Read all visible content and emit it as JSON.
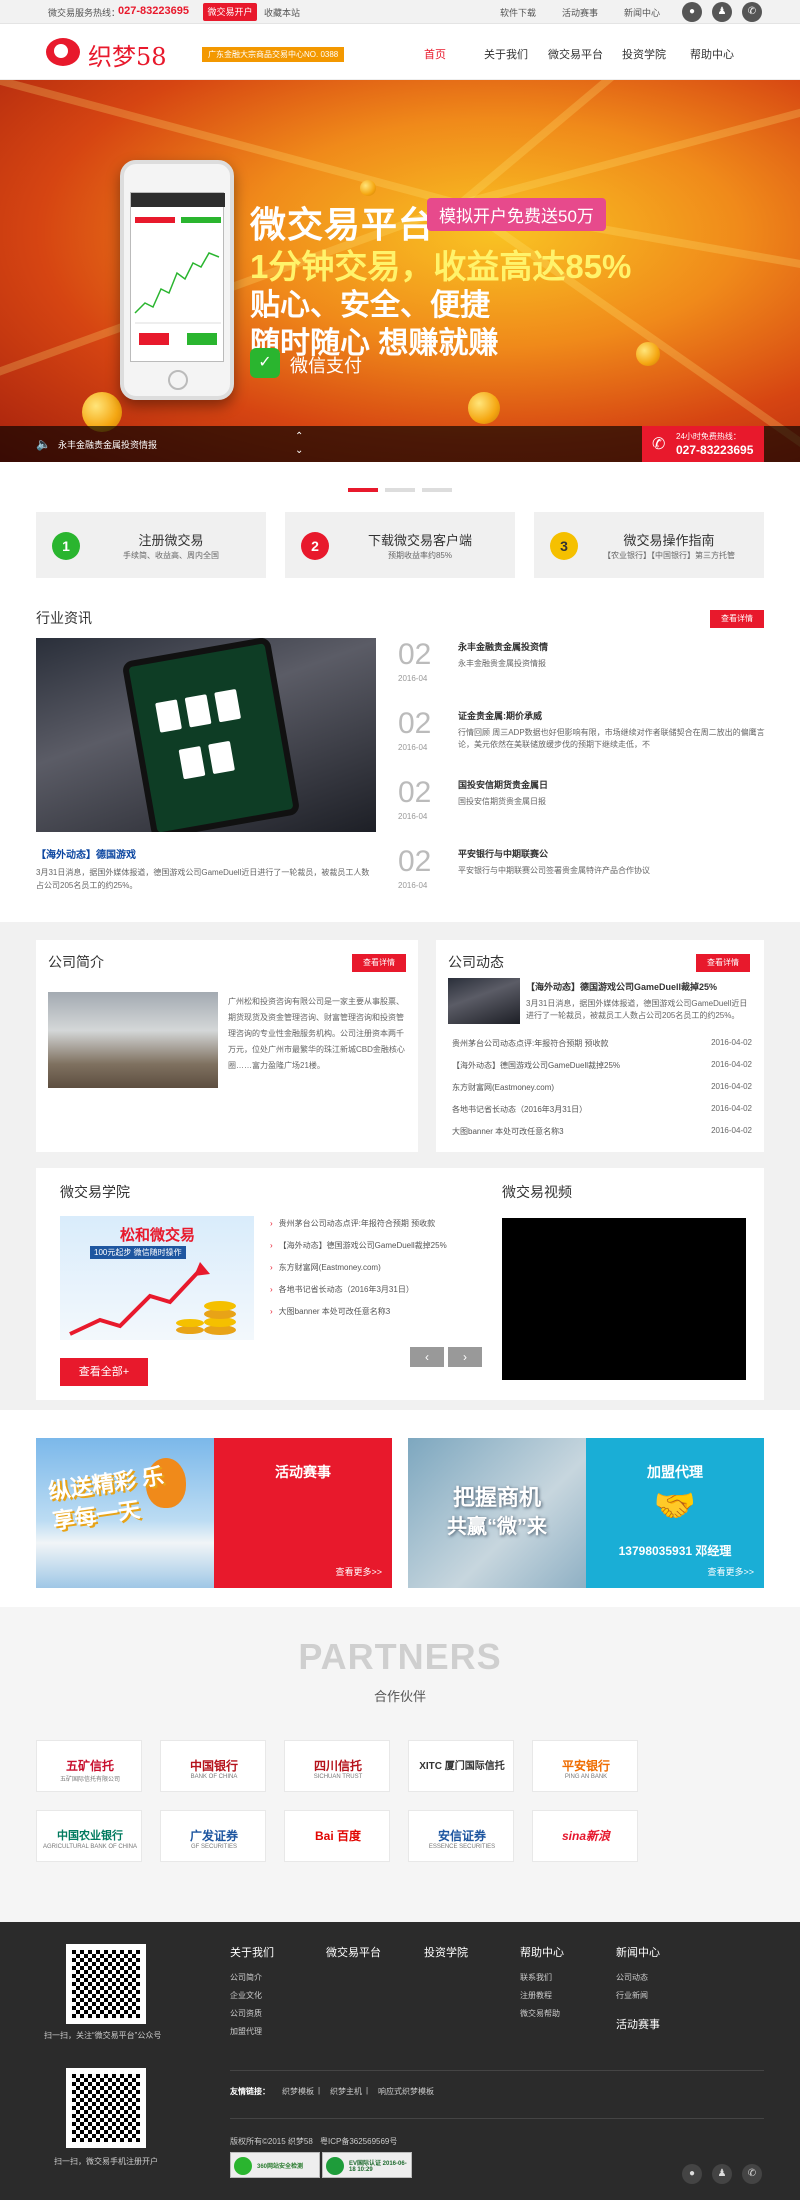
{
  "topbar": {
    "hotline_label": "微交易服务热线：",
    "hotline_number": "027-83223695",
    "open_account": "微交易开户",
    "bookmark": "收藏本站",
    "links": [
      "软件下载",
      "活动赛事",
      "新闻中心"
    ]
  },
  "header": {
    "logo_text": "织梦58",
    "badge": "广东金融大宗商品交易中心NO. 0388",
    "nav": [
      "首页",
      "关于我们",
      "微交易平台",
      "投资学院",
      "帮助中心"
    ]
  },
  "banner": {
    "title": "微交易平台",
    "tag": "模拟开户免费送50万",
    "line1": "1分钟交易，收益高达85%",
    "line2": "贴心、安全、便捷",
    "line3": "随时随心  想赚就赚",
    "wechat_pay": "微信支付",
    "ticker": "永丰金融贵金属投资情报",
    "hotline_label": "24小时免费热线：",
    "hotline_number": "027-83223695"
  },
  "steps": [
    {
      "num": "1",
      "title": "注册微交易",
      "sub": "手续简、收益高、周内全国"
    },
    {
      "num": "2",
      "title": "下载微交易客户端",
      "sub": "预期收益率约85%"
    },
    {
      "num": "3",
      "title": "微交易操作指南",
      "sub": "【农业银行】【中国银行】第三方托管"
    }
  ],
  "news": {
    "title": "行业资讯",
    "more": "查看详情",
    "caption": "【海外动态】德国游戏",
    "desc": "3月31日消息，据国外媒体报道，德国游戏公司GameDuell近日进行了一轮裁员，被裁员工人数占公司205名员工的约25%。",
    "items": [
      {
        "day": "02",
        "ym": "2016-04",
        "title": "永丰金融贵金属投资情",
        "desc": "永丰金融贵金属投资情报"
      },
      {
        "day": "02",
        "ym": "2016-04",
        "title": "证金贵金属:期价承威",
        "desc": "行情回顾 周三ADP数据也好但影响有限，市场继续对作者联储契合在周二放出的偏鹰言论，美元依然在美联储放缓步伐的预期下继续走低，不"
      },
      {
        "day": "02",
        "ym": "2016-04",
        "title": "国投安信期货贵金属日",
        "desc": "国投安信期货贵金属日报"
      },
      {
        "day": "02",
        "ym": "2016-04",
        "title": "平安银行与中期联赛公",
        "desc": "平安银行与中期联赛公司签署贵金属特许产品合作协议"
      }
    ]
  },
  "company": {
    "title": "公司简介",
    "more": "查看详情",
    "text": "广州松和投资咨询有限公司是一家主要从事股票、期货现货及资金管理咨询、财富管理咨询和投资管理咨询的专业性金融服务机构。公司注册资本两千万元，位处广州市最繁华的珠江新城CBD金融核心圈……富力盈隆广场21楼。"
  },
  "dynamics": {
    "title": "公司动态",
    "more": "查看详情",
    "head": "【海外动态】德国游戏公司GameDuell裁掉25%",
    "desc": "3月31日消息，据国外媒体报道，德国游戏公司GameDuell近日进行了一轮裁员，被裁员工人数占公司205名员工的约25%。",
    "items": [
      {
        "title": "贵州茅台公司动态点评:年报符合预期 预收款",
        "date": "2016-04-02"
      },
      {
        "title": "【海外动态】德国游戏公司GameDuell裁掉25%",
        "date": "2016-04-02"
      },
      {
        "title": "东方财富网(Eastmoney.com)",
        "date": "2016-04-02"
      },
      {
        "title": "各地书记省长动态（2016年3月31日）",
        "date": "2016-04-02"
      },
      {
        "title": "大图banner 本处可改任意名称3",
        "date": "2016-04-02"
      }
    ]
  },
  "academy": {
    "title": "微交易学院",
    "img_title": "松和微交易",
    "img_sub": "100元起步 微信随时操作",
    "items": [
      "贵州茅台公司动态点评:年报符合预期 预收款",
      "【海外动态】德国游戏公司GameDuell裁掉25%",
      "东方财富网(Eastmoney.com)",
      "各地书记省长动态（2016年3月31日）",
      "大图banner 本处可改任意名称3"
    ],
    "view_all": "查看全部+",
    "prev": "‹",
    "next": "›"
  },
  "video": {
    "title": "微交易视频"
  },
  "promo": {
    "left_title": "活动赛事",
    "left_more": "查看更多>>",
    "left_img_text": "纵送精彩 乐享每一天",
    "right_img_text1": "把握商机",
    "right_img_text2": "共赢“微”来",
    "right_title": "加盟代理",
    "right_phone": "13798035931 邓经理",
    "right_more": "查看更多>>"
  },
  "partners": {
    "title": "PARTNERS",
    "sub": "合作伙伴",
    "row1": [
      {
        "name": "五矿信托",
        "sub": "五矿国际信托有限公司",
        "color": "#c8102e"
      },
      {
        "name": "中国银行",
        "sub": "BANK OF CHINA",
        "color": "#b5121b"
      },
      {
        "name": "四川信托",
        "sub": "SICHUAN TRUST",
        "color": "#b5121b"
      },
      {
        "name": "XITC 厦门国际信托",
        "sub": "",
        "color": "#333333"
      },
      {
        "name": "平安银行",
        "sub": "PING AN BANK",
        "color": "#ef6c00"
      }
    ],
    "row2": [
      {
        "name": "中国农业银行",
        "sub": "AGRICULTURAL BANK OF CHINA",
        "color": "#007a5e"
      },
      {
        "name": "广发证券",
        "sub": "GF SECURITIES",
        "color": "#1e56a0"
      },
      {
        "name": "Bai 百度",
        "sub": "",
        "color": "#e10602"
      },
      {
        "name": "安信证券",
        "sub": "ESSENCE SECURITIES",
        "color": "#1e56a0"
      },
      {
        "name": "sina新浪",
        "sub": "",
        "color": "#e6162d"
      }
    ]
  },
  "footer": {
    "qr1_caption": "扫一扫，关注“微交易平台”公众号",
    "qr2_caption": "扫一扫，微交易手机注册开户",
    "cols": [
      {
        "head": "关于我们",
        "links": [
          "公司简介",
          "企业文化",
          "公司资质",
          "加盟代理"
        ]
      },
      {
        "head": "微交易平台",
        "links": []
      },
      {
        "head": "投资学院",
        "links": []
      },
      {
        "head": "帮助中心",
        "links": [
          "联系我们",
          "注册教程",
          "微交易帮助"
        ]
      },
      {
        "head": "新闻中心",
        "links": [
          "公司动态",
          "行业新闻"
        ]
      }
    ],
    "extra_head": "活动赛事",
    "friend_label": "友情链接：",
    "friend_links": [
      "织梦模板",
      "织梦主机",
      "响应式织梦模板"
    ],
    "copyright": "版权所有©2015 织梦58",
    "icp": "粤ICP备362569569号",
    "cert1": "360网站安全检测",
    "cert2": "EV国际认证 2016-06-18 10:29"
  },
  "colors": {
    "accent": "#e8192c",
    "teal": "#1aaed6",
    "orange": "#f39800"
  }
}
